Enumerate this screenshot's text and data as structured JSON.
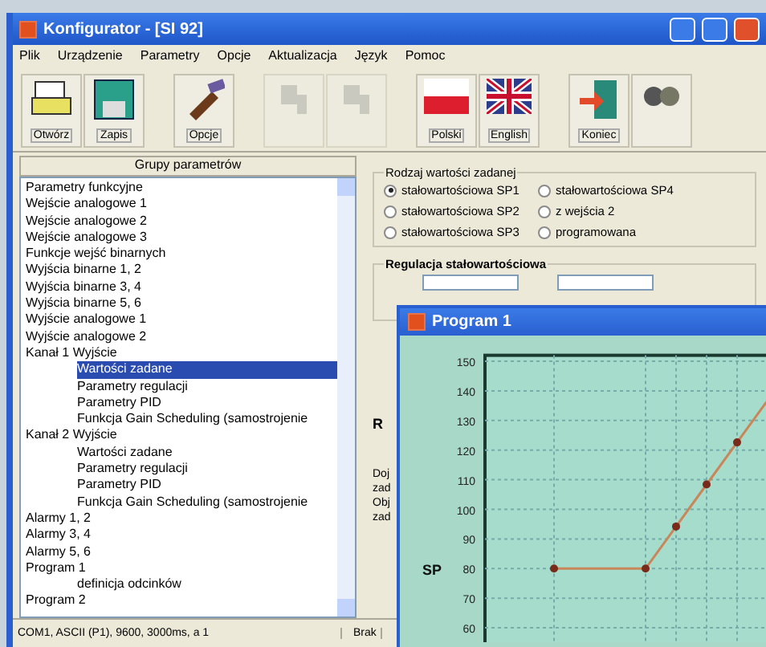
{
  "window": {
    "title": "Konfigurator - [SI 92]"
  },
  "menu": [
    "Plik",
    "Urządzenie",
    "Parametry",
    "Opcje",
    "Aktualizacja",
    "Język",
    "Pomoc"
  ],
  "toolbar": [
    {
      "kind": "open",
      "label": "Otwórz",
      "disabled": false
    },
    {
      "kind": "save",
      "label": "Zapis",
      "disabled": false
    },
    {
      "kind": "options",
      "label": "Opcje",
      "disabled": false
    },
    {
      "kind": "device",
      "disabled": true
    },
    {
      "kind": "device",
      "disabled": true
    },
    {
      "kind": "flag-pl",
      "label": "Polski",
      "disabled": false
    },
    {
      "kind": "flag-en",
      "label": "English",
      "disabled": false
    },
    {
      "kind": "exit",
      "label": "Koniec",
      "disabled": false
    },
    {
      "kind": "link",
      "disabled": false
    }
  ],
  "sidebar": {
    "title": "Grupy parametrów",
    "items": [
      {
        "label": "Parametry funkcyjne",
        "selected": false
      },
      {
        "label": "Wejście analogowe 1",
        "selected": false
      },
      {
        "label": "Wejście analogowe 2",
        "selected": false
      },
      {
        "label": "Wejście analogowe 3",
        "selected": false
      },
      {
        "label": "Funkcje wejść binarnych",
        "selected": false
      },
      {
        "label": "Wyjścia binarne 1, 2",
        "selected": false
      },
      {
        "label": "Wyjścia binarne 3, 4",
        "selected": false
      },
      {
        "label": "Wyjścia binarne 5, 6",
        "selected": false
      },
      {
        "label": "Wyjście analogowe 1",
        "selected": false
      },
      {
        "label": "Wyjście analogowe 2",
        "selected": false
      },
      {
        "label": "Kanał 1 Wyjście",
        "selected": false,
        "children": [
          {
            "label": "Wartości zadane",
            "selected": true
          },
          {
            "label": "Parametry regulacji",
            "selected": false
          },
          {
            "label": "Parametry PID",
            "selected": false
          },
          {
            "label": "Funkcja Gain Scheduling (samostrojenie",
            "selected": false
          }
        ]
      },
      {
        "label": "Kanał 2 Wyjście",
        "selected": false,
        "children": [
          {
            "label": "Wartości zadane",
            "selected": false
          },
          {
            "label": "Parametry regulacji",
            "selected": false
          },
          {
            "label": "Parametry PID",
            "selected": false
          },
          {
            "label": "Funkcja Gain Scheduling (samostrojenie",
            "selected": false
          }
        ]
      },
      {
        "label": "Alarmy 1, 2",
        "selected": false
      },
      {
        "label": "Alarmy 3, 4",
        "selected": false
      },
      {
        "label": "Alarmy 5, 6",
        "selected": false
      },
      {
        "label": "Program 1",
        "selected": false,
        "children": [
          {
            "label": "definicja odcinków",
            "selected": false
          }
        ]
      },
      {
        "label": "Program 2",
        "selected": false
      }
    ]
  },
  "setpoint_group": {
    "title": "Rodzaj wartości zadanej",
    "options": [
      {
        "label": "stałowartościowa SP1",
        "selected": true
      },
      {
        "label": "stałowartościowa SP4",
        "selected": false
      },
      {
        "label": "stałowartościowa SP2",
        "selected": false
      },
      {
        "label": "z wejścia 2",
        "selected": false
      },
      {
        "label": "stałowartościowa SP3",
        "selected": false
      },
      {
        "label": "programowana",
        "selected": false
      }
    ]
  },
  "fixed_group": {
    "title": "Regulacja stałowartościowa"
  },
  "fragments": {
    "heading": "R",
    "lines": [
      "Doj",
      "zad",
      "Obj",
      "zad"
    ]
  },
  "status_bar": [
    "COM1, ASCII (P1), 9600, 3000ms, a 1",
    "Brak"
  ],
  "program_window": {
    "title": "Program 1",
    "chart_data": {
      "type": "line",
      "ylabel": "SP",
      "grid": true,
      "series": [
        {
          "color": "#c8865a",
          "values": [
            null,
            null,
            80,
            80,
            80,
            80,
            94.2,
            108.4,
            122.6,
            136.8
          ]
        }
      ],
      "ylim": [
        55,
        152
      ],
      "yticks": [
        60,
        70,
        80,
        90,
        100,
        110,
        120,
        130,
        140,
        150
      ]
    }
  }
}
